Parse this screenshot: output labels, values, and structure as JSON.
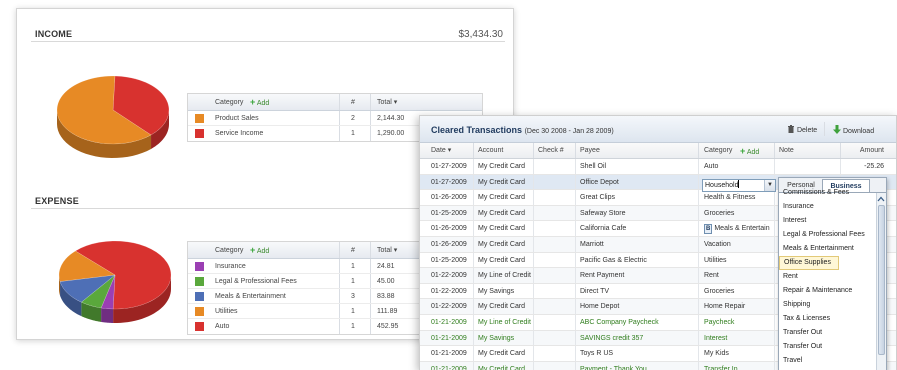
{
  "income": {
    "title": "INCOME",
    "total": "$3,434.30",
    "header": {
      "category": "Category",
      "add": "Add",
      "num": "#",
      "total": "Total ▾"
    },
    "rows": [
      {
        "color": "#e78a25",
        "category": "Product Sales",
        "count": "2",
        "total": "2,144.30"
      },
      {
        "color": "#d8322f",
        "category": "Service Income",
        "count": "1",
        "total": "1,290.00"
      }
    ],
    "pie": [
      1290.0,
      2144.3
    ],
    "pie_colors": [
      "#d8322f",
      "#e78a25"
    ]
  },
  "expense": {
    "title": "EXPENSE",
    "header": {
      "category": "Category",
      "add": "Add",
      "num": "#",
      "total": "Total ▾"
    },
    "rows": [
      {
        "color": "#9b3fb3",
        "category": "Insurance",
        "count": "1",
        "total": "24.81"
      },
      {
        "color": "#5aa83c",
        "category": "Legal & Professional Fees",
        "count": "1",
        "total": "45.00"
      },
      {
        "color": "#4e6fb6",
        "category": "Meals & Entertainment",
        "count": "3",
        "total": "83.88"
      },
      {
        "color": "#e78a25",
        "category": "Utilities",
        "count": "1",
        "total": "111.89"
      },
      {
        "color": "#d8322f",
        "category": "Auto",
        "count": "1",
        "total": "452.95"
      }
    ],
    "pie": [
      452.95,
      24.81,
      45.0,
      83.88,
      111.89
    ],
    "pie_colors": [
      "#d8322f",
      "#9b3fb3",
      "#5aa83c",
      "#4e6fb6",
      "#e78a25"
    ]
  },
  "cleared": {
    "title": "Cleared Transactions",
    "range": "(Dec 30 2008 - Jan 28 2009)",
    "delete_label": "Delete",
    "download_label": "Download",
    "columns": {
      "date": "Date ▾",
      "account": "Account",
      "check": "Check #",
      "payee": "Payee",
      "category": "Category",
      "add": "Add",
      "note": "Note",
      "amount": "Amount"
    },
    "rows": [
      {
        "date": "01-27-2009",
        "account": "My Credit Card",
        "payee": "Shell Oil",
        "category": "Auto",
        "amount": "-25.26",
        "green": false
      },
      {
        "date": "01-27-2009",
        "account": "My Credit Card",
        "payee": "Office Depot",
        "category": "",
        "amount": "",
        "green": false
      },
      {
        "date": "01-26-2009",
        "account": "My Credit Card",
        "payee": "Great Clips",
        "category": "Health & Fitness",
        "amount": "",
        "green": false
      },
      {
        "date": "01-25-2009",
        "account": "My Credit Card",
        "payee": "Safeway Store",
        "category": "Groceries",
        "amount": "",
        "green": false
      },
      {
        "date": "01-26-2009",
        "account": "My Credit Card",
        "payee": "California Cafe",
        "category": "Meals & Entertain",
        "amount": "",
        "green": false
      },
      {
        "date": "01-26-2009",
        "account": "My Credit Card",
        "payee": "Marriott",
        "category": "Vacation",
        "amount": "",
        "green": false
      },
      {
        "date": "01-25-2009",
        "account": "My Credit Card",
        "payee": "Pacific Gas & Electric",
        "category": "Utilities",
        "amount": "",
        "green": false
      },
      {
        "date": "01-22-2009",
        "account": "My Line of Credit",
        "payee": "Rent Payment",
        "category": "Rent",
        "amount": "",
        "green": false
      },
      {
        "date": "01-22-2009",
        "account": "My Savings",
        "payee": "Direct TV",
        "category": "Groceries",
        "amount": "",
        "green": false
      },
      {
        "date": "01-22-2009",
        "account": "My Credit Card",
        "payee": "Home Depot",
        "category": "Home Repair",
        "amount": "",
        "green": false
      },
      {
        "date": "01-21-2009",
        "account": "My Line of Credit",
        "payee": "ABC Company Paycheck",
        "category": "Paycheck",
        "amount": "",
        "green": true
      },
      {
        "date": "01-21-2009",
        "account": "My Savings",
        "payee": "SAVINGS credit 357",
        "category": "Interest",
        "amount": "",
        "green": true
      },
      {
        "date": "01-21-2009",
        "account": "My Credit Card",
        "payee": "Toys R US",
        "category": "My Kids",
        "amount": "",
        "green": false
      },
      {
        "date": "01-21-2009",
        "account": "My Credit Card",
        "payee": "Payment - Thank You",
        "category": "Transfer In",
        "amount": "",
        "green": true
      }
    ],
    "editing_value": "Household",
    "badge": "B",
    "dropdown": {
      "tabs": [
        "Personal",
        "Business"
      ],
      "active_tab": "Business",
      "items": [
        "Commissions & Fees",
        "Insurance",
        "Interest",
        "Legal & Professional Fees",
        "Meals & Entertainment",
        "Office Supplies",
        "Rent",
        "Repair & Maintenance",
        "Shipping",
        "Tax & Licenses",
        "Transfer Out",
        "Transfer Out",
        "Travel"
      ],
      "highlighted": "Office Supplies"
    }
  }
}
